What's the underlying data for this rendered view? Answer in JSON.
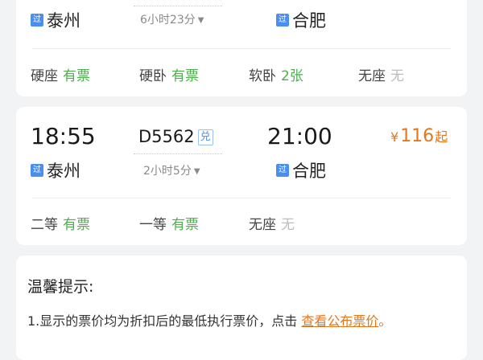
{
  "cards": [
    {
      "from_station": "泰州",
      "to_station": "合肥",
      "pass_badge": "过",
      "duration": "6小时23分",
      "seats": [
        {
          "type": "硬座",
          "status": "有票",
          "tone": "green"
        },
        {
          "type": "硬卧",
          "status": "有票",
          "tone": "green"
        },
        {
          "type": "软卧",
          "status": "2张",
          "tone": "green"
        },
        {
          "type": "无座",
          "status": "无",
          "tone": "gray"
        }
      ]
    },
    {
      "depart_time": "18:55",
      "arrive_time": "21:00",
      "train_no": "D5562",
      "exchange_badge": "兑",
      "from_station": "泰州",
      "to_station": "合肥",
      "pass_badge": "过",
      "duration": "2小时5分",
      "price_currency": "¥",
      "price": "116",
      "price_suffix": "起",
      "seats": [
        {
          "type": "二等",
          "status": "有票",
          "tone": "green"
        },
        {
          "type": "一等",
          "status": "有票",
          "tone": "green"
        },
        {
          "type": "无座",
          "status": "无",
          "tone": "gray"
        }
      ]
    }
  ],
  "tips": {
    "title": "温馨提示:",
    "line1_text": "1.显示的票价均为折扣后的最低执行票价，点击",
    "line1_link": "查看公布票价",
    "line1_end": "。"
  },
  "colors": {
    "accent_orange": "#e2781b",
    "available_green": "#4cae4c",
    "badge_blue": "#4a8ef0"
  },
  "icons": {
    "dropdown": "caret-down-icon"
  }
}
